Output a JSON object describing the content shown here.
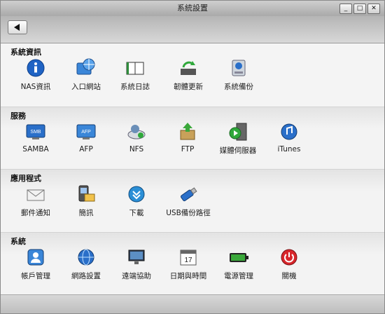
{
  "window": {
    "title": "系統設置",
    "controls": [
      "_",
      "□",
      "✕"
    ]
  },
  "sections": [
    {
      "title": "系統資訊",
      "items": [
        {
          "label": "NAS資訊",
          "icon": "info-icon"
        },
        {
          "label": "入口網站",
          "icon": "portal-icon"
        },
        {
          "label": "系統日誌",
          "icon": "log-book-icon"
        },
        {
          "label": "韌體更新",
          "icon": "firmware-update-icon"
        },
        {
          "label": "系統備份",
          "icon": "system-backup-icon"
        }
      ]
    },
    {
      "title": "服務",
      "items": [
        {
          "label": "SAMBA",
          "icon": "samba-icon"
        },
        {
          "label": "AFP",
          "icon": "afp-icon"
        },
        {
          "label": "NFS",
          "icon": "nfs-icon"
        },
        {
          "label": "FTP",
          "icon": "ftp-icon"
        },
        {
          "label": "媒體伺服器",
          "icon": "media-server-icon"
        },
        {
          "label": "iTunes",
          "icon": "itunes-icon"
        }
      ]
    },
    {
      "title": "應用程式",
      "items": [
        {
          "label": "郵件通知",
          "icon": "mail-notification-icon"
        },
        {
          "label": "簡訊",
          "icon": "sms-icon"
        },
        {
          "label": "下載",
          "icon": "download-icon"
        },
        {
          "label": "USB備份路徑",
          "icon": "usb-backup-icon"
        }
      ]
    },
    {
      "title": "系統",
      "items": [
        {
          "label": "帳戶管理",
          "icon": "account-icon"
        },
        {
          "label": "網路設置",
          "icon": "network-icon"
        },
        {
          "label": "遠端協助",
          "icon": "remote-assist-icon"
        },
        {
          "label": "日期與時間",
          "icon": "calendar-icon"
        },
        {
          "label": "電源管理",
          "icon": "battery-icon"
        },
        {
          "label": "關機",
          "icon": "power-icon"
        }
      ]
    }
  ],
  "colors": {
    "accent": "#2a6fc9",
    "power": "#d8262b",
    "battery": "#3aa83a"
  }
}
